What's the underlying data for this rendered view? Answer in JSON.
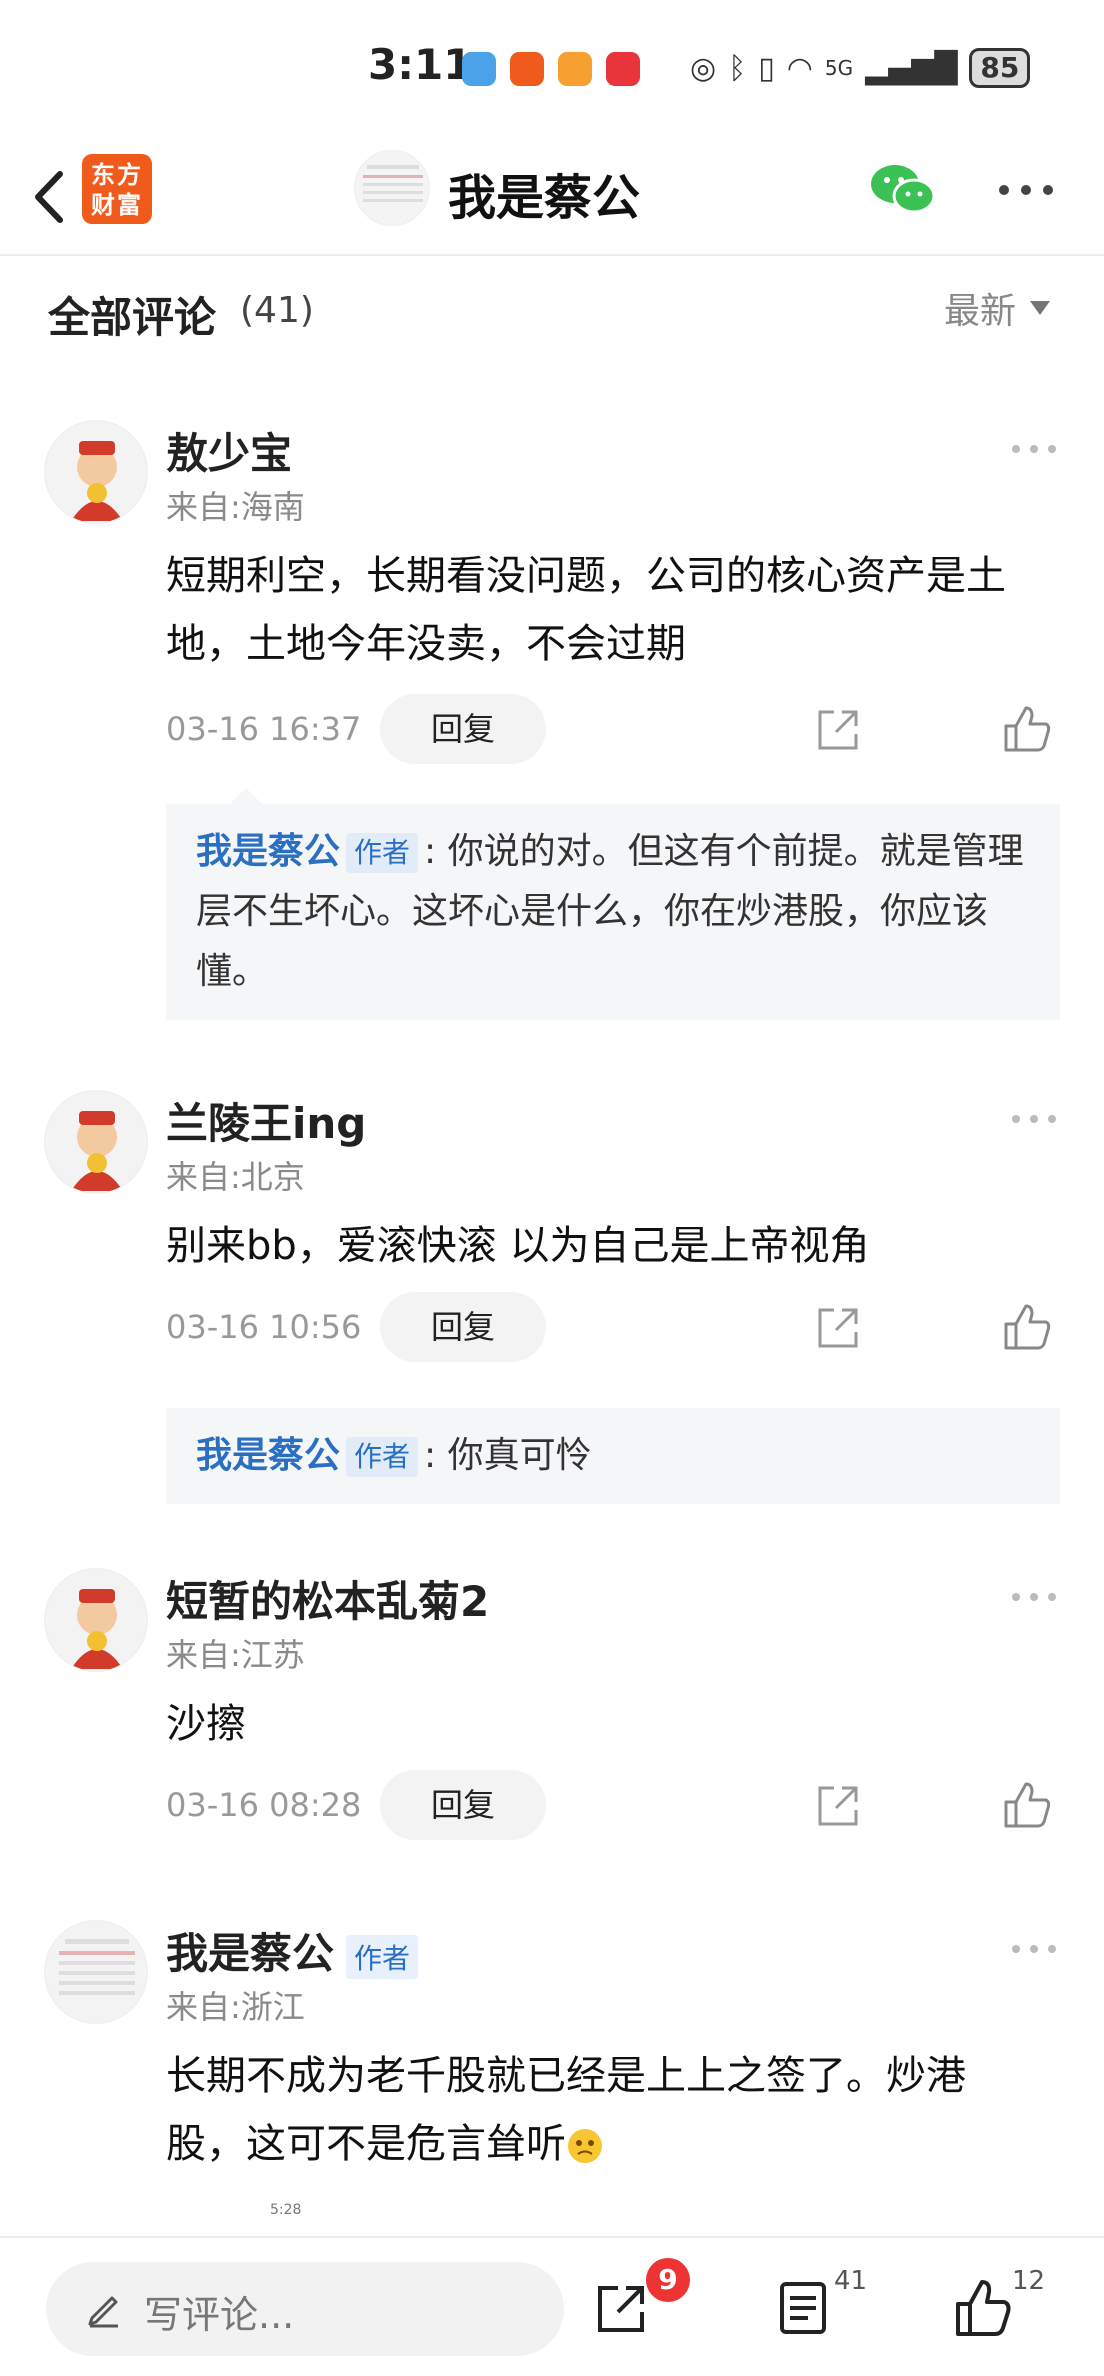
{
  "status_bar": {
    "time": "3:11",
    "battery": "85",
    "network": "5G"
  },
  "header": {
    "brand_logo_text": "东方财富",
    "title": "我是蔡公"
  },
  "comments_section": {
    "heading": "全部评论",
    "count": "(41)",
    "sort_label": "最新"
  },
  "comments": [
    {
      "username": "敖少宝",
      "location": "来自:海南",
      "body": "短期利空，长期看没问题，公司的核心资产是土地，土地今年没卖，不会过期",
      "timestamp": "03-16 16:37",
      "reply_label": "回复",
      "reply": {
        "name": "我是蔡公",
        "badge": "作者",
        "text": ": 你说的对。但这有个前提。就是管理层不生坏心。这坏心是什么，你在炒港股，你应该懂。"
      }
    },
    {
      "username": "兰陵王ing",
      "location": "来自:北京",
      "body": "别来bb，爱滚快滚 以为自己是上帝视角",
      "timestamp": "03-16 10:56",
      "reply_label": "回复",
      "reply": {
        "name": "我是蔡公",
        "badge": "作者",
        "text": ": 你真可怜"
      }
    },
    {
      "username": "短暂的松本乱菊2",
      "location": "来自:江苏",
      "body": "沙擦",
      "timestamp": "03-16 08:28",
      "reply_label": "回复"
    },
    {
      "username": "我是蔡公",
      "author_badge": "作者",
      "location": "来自:浙江",
      "body": "长期不成为老千股就已经是上上之签了。炒港股，这可不是危言耸听"
    }
  ],
  "embedded_preview_time": "5:28",
  "bottom_bar": {
    "input_placeholder": "写评论...",
    "share_badge": "9",
    "comment_count": "41",
    "like_count": "12"
  },
  "colors": {
    "brand": "#f05a1a",
    "link_blue": "#2b6fc2",
    "badge_red": "#ee3333",
    "wechat_green": "#3cc254"
  }
}
